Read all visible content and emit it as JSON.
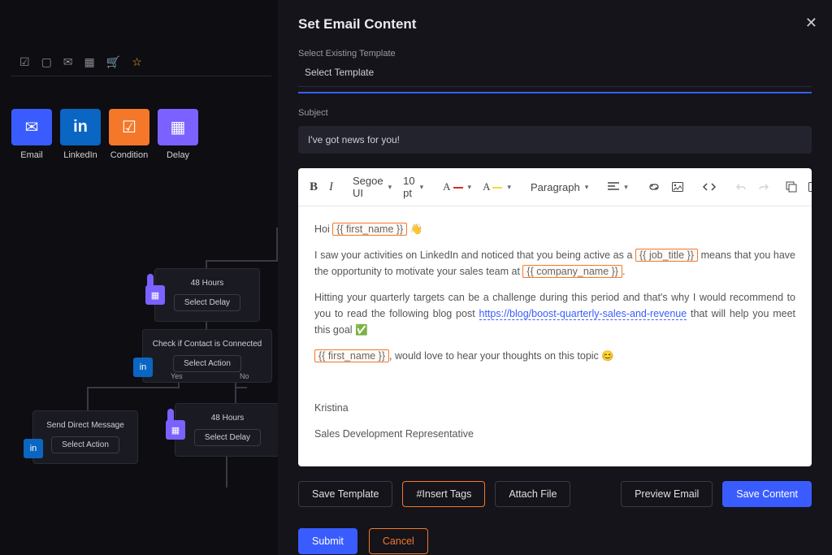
{
  "left": {
    "actions": {
      "email": "Email",
      "linkedin": "LinkedIn",
      "condition": "Condition",
      "delay": "Delay"
    },
    "nodes": {
      "delay1_title": "48 Hours",
      "delay1_btn": "Select Delay",
      "condition_title": "Check if Contact is Connected",
      "condition_btn": "Select Action",
      "yes": "Yes",
      "no": "No",
      "dm_title": "Send Direct Message",
      "dm_btn": "Select Action",
      "delay2_title": "48 Hours",
      "delay2_btn": "Select Delay"
    }
  },
  "modal": {
    "title": "Set Email Content",
    "template_label": "Select Existing Template",
    "template_value": "Select Template",
    "subject_label": "Subject",
    "subject_value": "I've got news for you!",
    "buttons": {
      "save_template": "Save Template",
      "insert_tags": "#Insert Tags",
      "attach_file": "Attach File",
      "preview": "Preview Email",
      "save_content": "Save Content",
      "submit": "Submit",
      "cancel": "Cancel"
    }
  },
  "editor": {
    "toolbar": {
      "font": "Segoe UI",
      "size": "10 pt",
      "paragraph": "Paragraph"
    },
    "body": {
      "greeting": "Hoi ",
      "tag_first_name": "{{ first_name }}",
      "wave": "👋",
      "p1_a": "I saw your activities on LinkedIn and noticed that you being active as a ",
      "tag_job_title": "{{ job_title }}",
      "p1_b": " means that you have the opportunity to motivate your sales team at ",
      "tag_company": "{{ company_name }}",
      "p1_c": ".",
      "p2_a": "Hitting your quarterly targets can be a challenge during this period and that's why I would recommend to you to read the following blog post ",
      "link": "https://blog/boost-quarterly-sales-and-revenue",
      "p2_b": " that will help you meet this goal ",
      "check": "✅",
      "p3_b": ", would love to hear your thoughts on this topic 😊",
      "sig_name": "Kristina",
      "sig_role": "Sales Development Representative"
    }
  }
}
